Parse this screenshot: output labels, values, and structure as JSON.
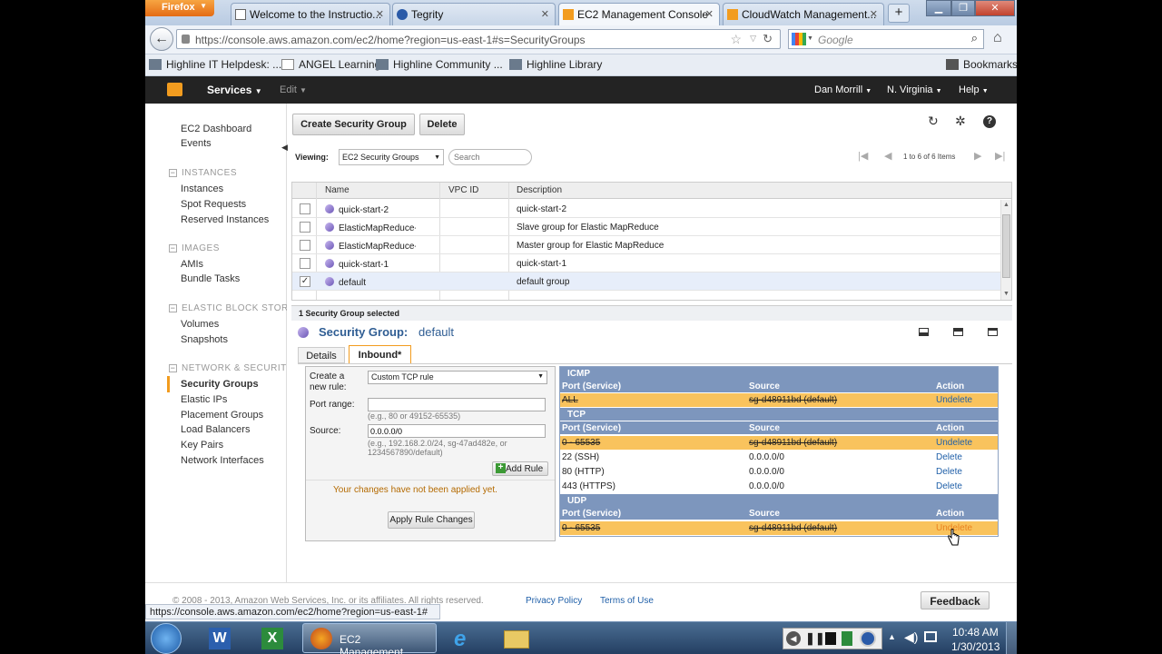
{
  "browser": {
    "firefox_label": "Firefox",
    "tabs": [
      {
        "title": "Welcome to the Instructio..."
      },
      {
        "title": "Tegrity"
      },
      {
        "title": "EC2 Management Console"
      },
      {
        "title": "CloudWatch Management..."
      }
    ],
    "new_tab": "+",
    "url": "https://console.aws.amazon.com/ec2/home?region=us-east-1#s=SecurityGroups",
    "search_placeholder": "Google",
    "bookmarks": [
      "Highline IT Helpdesk: ...",
      "ANGEL Learning",
      "Highline Community ...",
      "Highline Library"
    ],
    "bookmarks_menu": "Bookmarks",
    "status_url": "https://console.aws.amazon.com/ec2/home?region=us-east-1#"
  },
  "aws_nav": {
    "services": "Services",
    "edit": "Edit",
    "user": "Dan Morrill",
    "region": "N. Virginia",
    "help": "Help"
  },
  "sidebar": {
    "top": [
      "EC2 Dashboard",
      "Events"
    ],
    "sections": [
      {
        "title": "INSTANCES",
        "items": [
          "Instances",
          "Spot Requests",
          "Reserved Instances"
        ]
      },
      {
        "title": "IMAGES",
        "items": [
          "AMIs",
          "Bundle Tasks"
        ]
      },
      {
        "title": "ELASTIC BLOCK STORE",
        "items": [
          "Volumes",
          "Snapshots"
        ]
      },
      {
        "title": "NETWORK & SECURITY",
        "items": [
          "Security Groups",
          "Elastic IPs",
          "Placement Groups",
          "Load Balancers",
          "Key Pairs",
          "Network Interfaces"
        ]
      }
    ]
  },
  "toolbar": {
    "create": "Create Security Group",
    "delete": "Delete",
    "viewing_label": "Viewing:",
    "viewing_value": "EC2 Security Groups",
    "search_placeholder": "Search",
    "pager": "1 to 6 of 6 Items"
  },
  "grid": {
    "columns": [
      "Name",
      "VPC ID",
      "Description"
    ],
    "rows": [
      {
        "name": "quick-start-2",
        "vpc": "",
        "desc": "quick-start-2",
        "checked": false
      },
      {
        "name": "ElasticMapReduce-slave",
        "vpc": "",
        "desc": "Slave group for Elastic MapReduce",
        "checked": false
      },
      {
        "name": "ElasticMapReduce-maste",
        "vpc": "",
        "desc": "Master group for Elastic MapReduce",
        "checked": false
      },
      {
        "name": "quick-start-1",
        "vpc": "",
        "desc": "quick-start-1",
        "checked": false
      },
      {
        "name": "default",
        "vpc": "",
        "desc": "default group",
        "checked": true
      }
    ],
    "selected_count": "1 Security Group selected"
  },
  "detail": {
    "title_prefix": "Security Group:",
    "title_name": "default",
    "tabs": [
      "Details",
      "Inbound*"
    ]
  },
  "rule_form": {
    "create_label": "Create a new rule:",
    "rule_type": "Custom TCP rule",
    "port_label": "Port range:",
    "port_value": "",
    "port_hint": "(e.g., 80 or 49152-65535)",
    "source_label": "Source:",
    "source_value": "0.0.0.0/0",
    "source_hint": "(e.g., 192.168.2.0/24, sg-47ad482e, or 1234567890/default)",
    "add_rule": "Add Rule",
    "warning": "Your changes have not been applied yet.",
    "apply": "Apply Rule Changes"
  },
  "rules": {
    "col_port": "Port (Service)",
    "col_source": "Source",
    "col_action": "Action",
    "sections": [
      {
        "name": "ICMP",
        "rows": [
          {
            "port": "ALL",
            "source": "sg-d48911bd (default)",
            "action": "Undelete",
            "deleted": true
          }
        ]
      },
      {
        "name": "TCP",
        "rows": [
          {
            "port": "0 - 65535",
            "source": "sg-d48911bd (default)",
            "action": "Undelete",
            "deleted": true
          },
          {
            "port": "22 (SSH)",
            "source": "0.0.0.0/0",
            "action": "Delete",
            "deleted": false
          },
          {
            "port": "80 (HTTP)",
            "source": "0.0.0.0/0",
            "action": "Delete",
            "deleted": false
          },
          {
            "port": "443 (HTTPS)",
            "source": "0.0.0.0/0",
            "action": "Delete",
            "deleted": false
          }
        ]
      },
      {
        "name": "UDP",
        "rows": [
          {
            "port": "0 - 65535",
            "source": "sg-d48911bd (default)",
            "action": "Undelete",
            "deleted": true
          }
        ]
      }
    ]
  },
  "footer": {
    "copyright": "© 2008 - 2013, Amazon Web Services, Inc. or its affiliates. All rights reserved.",
    "privacy": "Privacy Policy",
    "terms": "Terms of Use",
    "feedback": "Feedback"
  },
  "taskbar": {
    "active_task": "EC2 Management...",
    "time": "10:48 AM",
    "date": "1/30/2013"
  },
  "colors": {
    "aws_orange": "#f29c1f",
    "nav_dark": "#232323",
    "rule_header": "#7d96bd",
    "deleted_row": "#f9c35d",
    "link": "#1f5fa8"
  }
}
